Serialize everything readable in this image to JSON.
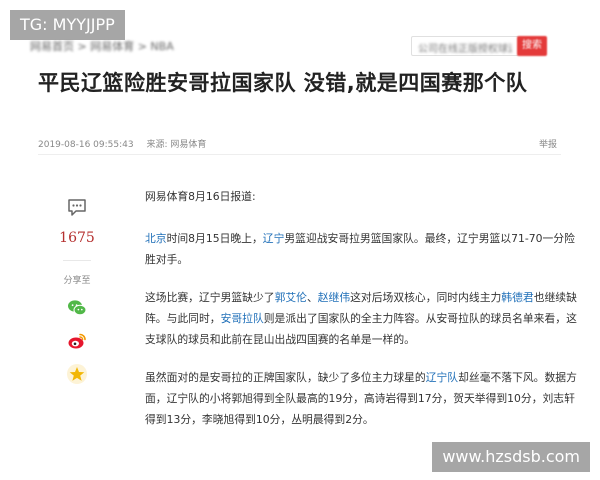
{
  "header": {
    "breadcrumb": "网易首页 > 网易体育 > NBA",
    "search_placeholder": "公司在线正版授权球迷中心",
    "search_button": "搜索"
  },
  "article": {
    "title": "平民辽篮险胜安哥拉国家队 没错,就是四国赛那个队",
    "date": "2019-08-16 09:55:43",
    "source": "来源: 网易体育",
    "report": "举报",
    "paragraphs": [
      [
        {
          "text": "网易体育8月16日报道:",
          "link": false
        }
      ],
      [
        {
          "text": "北京",
          "link": true
        },
        {
          "text": "时间8月15日晚上，",
          "link": false
        },
        {
          "text": "辽宁",
          "link": true
        },
        {
          "text": "男篮迎战安哥拉男篮国家队。最终，辽宁男篮以71-70一分险胜对手。",
          "link": false
        }
      ],
      [
        {
          "text": "这场比赛，辽宁男篮缺少了",
          "link": false
        },
        {
          "text": "郭艾伦",
          "link": true
        },
        {
          "text": "、",
          "link": false
        },
        {
          "text": "赵继伟",
          "link": true
        },
        {
          "text": "这对后场双核心，同时内线主力",
          "link": false
        },
        {
          "text": "韩德君",
          "link": true
        },
        {
          "text": "也继续缺阵。与此同时，",
          "link": false
        },
        {
          "text": "安哥拉队",
          "link": true
        },
        {
          "text": "则是派出了国家队的全主力阵容。从安哥拉队的球员名单来看，这支球队的球员和此前在昆山出战四国赛的名单是一样的。",
          "link": false
        }
      ],
      [
        {
          "text": "虽然面对的是安哥拉的正牌国家队，缺少了多位主力球星的",
          "link": false
        },
        {
          "text": "辽宁队",
          "link": true
        },
        {
          "text": "却丝毫不落下风。数据方面，辽宁队的小将郭旭得到全队最高的19分，高诗岩得到17分，贺天举得到10分，刘志轩得到13分，李晓旭得到10分，丛明晨得到2分。",
          "link": false
        }
      ]
    ]
  },
  "sidebar": {
    "comment_count": "1675",
    "share_label": "分享至",
    "icons": {
      "comment": "comment-icon",
      "wechat": "wechat-icon",
      "weibo": "weibo-icon",
      "favorite": "star-icon"
    },
    "colors": {
      "count": "#b5302f",
      "wechat": "#51b848",
      "weibo": "#e6162d",
      "star": "#f2b705"
    }
  },
  "watermarks": {
    "top": "TG: MYYJJPP",
    "bottom": "www.hzsdsb.com"
  },
  "colors": {
    "link": "#1f6fb8",
    "search_button": "#e43a3a",
    "title": "#222222"
  }
}
